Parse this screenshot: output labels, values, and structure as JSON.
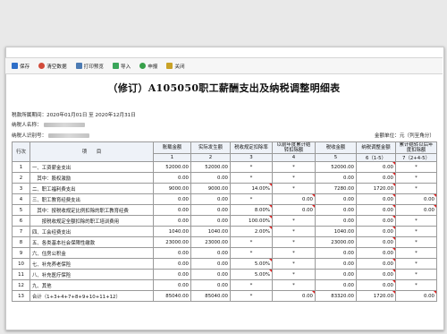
{
  "toolbar": {
    "buttons": [
      {
        "label": "保存",
        "icon": "save-icon",
        "color": "#2f6fc8"
      },
      {
        "label": "清空数据",
        "icon": "clear-icon",
        "color": "#d24b3a"
      },
      {
        "label": "打印预览",
        "icon": "printer-icon",
        "color": "#4c7bb3"
      },
      {
        "label": "导入",
        "icon": "import-icon",
        "color": "#3aa55a"
      },
      {
        "label": "申报",
        "icon": "check-icon",
        "color": "#37a04a"
      },
      {
        "label": "关闭",
        "icon": "close-icon",
        "color": "#c9a227"
      }
    ]
  },
  "form": {
    "title": "（修订）A105050职工薪酬支出及纳税调整明细表",
    "period": "税款所属期间：2020年01月01日 至 2020年12月31日",
    "taxpayer_name_label": "纳税人名称：",
    "taxpayer_id_label": "纳税人识别号：",
    "unit": "金额单位：元（列至角分）"
  },
  "table": {
    "headers": [
      "行次",
      "项　　目",
      "账载金额",
      "实际发生额",
      "税收规定扣除率",
      "以前年度累计结转扣除额",
      "税收金额",
      "纳税调整金额",
      "累计结转以后年度扣除额"
    ],
    "col_index": [
      "",
      "",
      "1",
      "2",
      "3",
      "4",
      "5",
      "6（1-5）",
      "7（2+4-5）"
    ],
    "rows": [
      {
        "line": "1",
        "item": "一、工资薪金支出",
        "c1": "52000.00",
        "c2": "52000.00",
        "c3": "*",
        "c4": "*",
        "c5": "52000.00",
        "c6": "0.00",
        "c7": "*"
      },
      {
        "line": "2",
        "item": "　其中：股权激励",
        "c1": "0.00",
        "c2": "0.00",
        "c3": "*",
        "c4": "*",
        "c5": "0.00",
        "c6": "0.00",
        "c7": "*"
      },
      {
        "line": "3",
        "item": "二、职工福利费支出",
        "c1": "9000.00",
        "c2": "9000.00",
        "c3": "14.00%",
        "c4": "*",
        "c5": "7280.00",
        "c6": "1720.00",
        "c7": "*"
      },
      {
        "line": "4",
        "item": "三、职工教育经费支出",
        "c1": "0.00",
        "c2": "0.00",
        "c3": "*",
        "c4": "0.00",
        "c5": "0.00",
        "c6": "0.00",
        "c7": "0.00"
      },
      {
        "line": "5",
        "item": "　其中：按税收规定比例扣除的职工教育经费",
        "c1": "0.00",
        "c2": "0.00",
        "c3": "8.00%",
        "c4": "0.00",
        "c5": "0.00",
        "c6": "0.00",
        "c7": "0.00"
      },
      {
        "line": "6",
        "item": "　　按税收规定全额扣除的职工培训费用",
        "c1": "0.00",
        "c2": "0.00",
        "c3": "100.00%",
        "c4": "*",
        "c5": "0.00",
        "c6": "0.00",
        "c7": "*"
      },
      {
        "line": "7",
        "item": "四、工会经费支出",
        "c1": "1040.00",
        "c2": "1040.00",
        "c3": "2.00%",
        "c4": "*",
        "c5": "1040.00",
        "c6": "0.00",
        "c7": "*"
      },
      {
        "line": "8",
        "item": "五、各类基本社会保障性缴款",
        "c1": "23000.00",
        "c2": "23000.00",
        "c3": "*",
        "c4": "*",
        "c5": "23000.00",
        "c6": "0.00",
        "c7": "*"
      },
      {
        "line": "9",
        "item": "六、住房公积金",
        "c1": "0.00",
        "c2": "0.00",
        "c3": "*",
        "c4": "*",
        "c5": "0.00",
        "c6": "0.00",
        "c7": "*"
      },
      {
        "line": "10",
        "item": "七、补充养老保险",
        "c1": "0.00",
        "c2": "0.00",
        "c3": "5.00%",
        "c4": "*",
        "c5": "0.00",
        "c6": "0.00",
        "c7": "*"
      },
      {
        "line": "11",
        "item": "八、补充医疗保险",
        "c1": "0.00",
        "c2": "0.00",
        "c3": "5.00%",
        "c4": "*",
        "c5": "0.00",
        "c6": "0.00",
        "c7": "*"
      },
      {
        "line": "12",
        "item": "九、其他",
        "c1": "0.00",
        "c2": "0.00",
        "c3": "*",
        "c4": "*",
        "c5": "0.00",
        "c6": "0.00",
        "c7": "*"
      },
      {
        "line": "13",
        "item": "合计（1+3+4+7+8+9+10+11+12）",
        "c1": "85040.00",
        "c2": "85040.00",
        "c3": "*",
        "c4": "0.00",
        "c5": "83320.00",
        "c6": "1720.00",
        "c7": "0.00"
      }
    ]
  }
}
